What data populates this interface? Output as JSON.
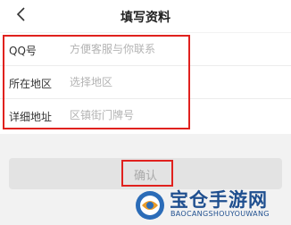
{
  "header": {
    "title": "填写资料",
    "back_icon": "chevron-left-icon"
  },
  "form": {
    "fields": [
      {
        "label": "QQ号",
        "placeholder": "方便客服与你联系",
        "value": ""
      },
      {
        "label": "所在地区",
        "placeholder": "选择地区",
        "value": ""
      },
      {
        "label": "详细地址",
        "placeholder": "区镇街门牌号",
        "value": ""
      }
    ]
  },
  "confirm": {
    "label": "确认"
  },
  "watermark": {
    "text": "宝仓手游网",
    "subtext": "BAOCANGSHOUYOUWANG"
  },
  "colors": {
    "highlight": "#e0211e",
    "button_bg": "#e3e3e3",
    "watermark": "#1f4f8f"
  }
}
